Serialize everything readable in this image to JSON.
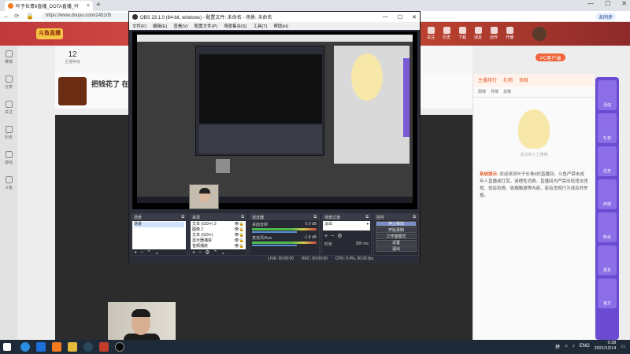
{
  "browser": {
    "tab_title": "叶子长青6直播_DOTA直播_叶",
    "url": "https://www.douyu.com/245105",
    "profile_label": "未同步",
    "minimize": "—",
    "maximize": "☐",
    "close": "✕"
  },
  "douyu": {
    "logo": "斗鱼直播",
    "nav_icons": [
      "关注",
      "历史",
      "下载",
      "消息",
      "创作",
      "开播"
    ],
    "left_items": [
      "推荐",
      "分类",
      "关注",
      "历史",
      "游戏",
      "斗鱼"
    ],
    "info_number": "12",
    "info_label": "主播等级",
    "stream_title": "把钱花了 在去",
    "pc_client": "PC客户端",
    "right_tabs": [
      "主播排行",
      "礼物",
      "贡献"
    ],
    "right_subtabs": [
      "周榜",
      "月榜",
      "总榜"
    ],
    "empty_text": "还没有人上榜哦",
    "notice_label": "系统提示:",
    "notice_text": "欢迎来到叶子长青6的直播间。斗鱼严禁未成年人直播或打赏，请理性消费。直播间内严禁出现违法违规、低俗色情、吸烟酗酒等内容，若有违规行为请及时举报。",
    "promos": [
      "活动",
      "礼包",
      "任务",
      "商城",
      "粉丝",
      "更多",
      "官方",
      "推荐"
    ]
  },
  "obs": {
    "title": "OBS 23.1.0 (64-bit, windows) - 配置文件: 未命名 - 场景: 未命名",
    "menu": [
      "文件(F)",
      "编辑(E)",
      "查看(V)",
      "配置文件(P)",
      "场景集合(S)",
      "工具(T)",
      "帮助(H)"
    ],
    "docks": {
      "scenes": {
        "title": "场景",
        "items": [
          "场景"
        ]
      },
      "sources": {
        "title": "来源",
        "items": [
          "文本 (GDI+) 3",
          "图像 2",
          "文本 (GDI+)",
          "显示器捕获",
          "音频捕获"
        ]
      },
      "mixer": {
        "title": "混音器",
        "channels": [
          {
            "name": "桌面音频",
            "db": "0.0 dB"
          },
          {
            "name": "麦克风/Aux",
            "db": "-1.8 dB"
          }
        ]
      },
      "transitions": {
        "title": "场景过渡",
        "selected": "淡出",
        "duration_label": "时长",
        "duration": "300 ms"
      },
      "controls": {
        "title": "控件",
        "buttons": [
          "停止推流",
          "开始录制",
          "工作室模式",
          "设置",
          "退出"
        ]
      }
    },
    "status": {
      "live": "LIVE: 00:00:00",
      "rec": "REC: 00:00:00",
      "cpu": "CPU: 0.4%, 30.00 fps"
    }
  },
  "taskbar": {
    "lang": "ENG",
    "time": "0:38",
    "date": "2021/12/14",
    "ime": "拼"
  }
}
